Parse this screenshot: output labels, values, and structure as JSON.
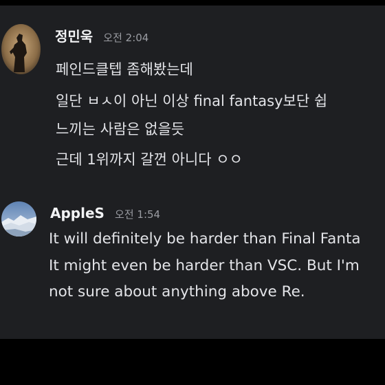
{
  "messages": [
    {
      "username": "정민욱",
      "timestamp": "오전 2:04",
      "avatar_icon": "user-silhouette-icon",
      "lines": [
        "페인드클텝 좀해봤는데",
        "일단 ㅂㅅ이 아닌 이상 final fantasy보단 쉽",
        "느끼는 사람은 없을듯",
        "근데 1위까지 갈껀 아니다 ㅇㅇ"
      ]
    },
    {
      "username": "AppleS",
      "timestamp": "오전 1:54",
      "avatar_icon": "mountain-landscape-icon",
      "lines": [
        "It will definitely be harder than Final Fanta",
        "It might even be harder than VSC. But I'm",
        "not sure about anything above Re."
      ]
    }
  ],
  "colors": {
    "background": "#1e1f22",
    "frame": "#000000",
    "text": "#e3e4e8",
    "username": "#f2f3f5",
    "timestamp": "#9b9da3"
  }
}
